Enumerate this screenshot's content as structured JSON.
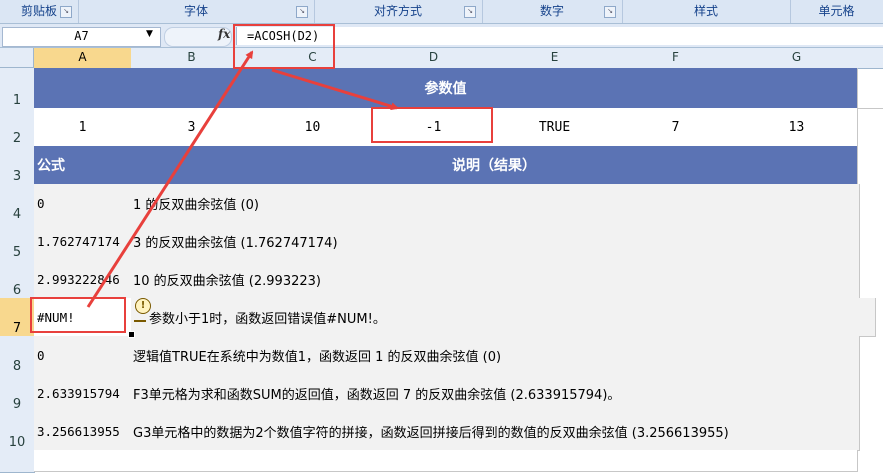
{
  "ribbon": {
    "groups": [
      "剪贴板",
      "字体",
      "对齐方式",
      "数字",
      "样式",
      "单元格"
    ]
  },
  "formula_bar": {
    "name_box": "A7",
    "fx_label": "fx",
    "formula": "=ACOSH(D2)"
  },
  "columns": [
    "A",
    "B",
    "C",
    "D",
    "E",
    "F",
    "G"
  ],
  "rows": [
    "1",
    "2",
    "3",
    "4",
    "5",
    "6",
    "7",
    "8",
    "9",
    "10"
  ],
  "sheet": {
    "title": "参数值",
    "params": [
      "1",
      "3",
      "10",
      "-1",
      "TRUE",
      "7",
      "13"
    ],
    "formula_header": "公式",
    "desc_header": "说明（结果）",
    "results": [
      {
        "value": "0",
        "desc": "1 的反双曲余弦值 (0)"
      },
      {
        "value": "1.762747174",
        "desc": "3 的反双曲余弦值 (1.762747174)"
      },
      {
        "value": "2.993222846",
        "desc": "10 的反双曲余弦值 (2.993223)"
      },
      {
        "value": "#NUM!",
        "desc": "参数小于1时，函数返回错误值#NUM!。"
      },
      {
        "value": "0",
        "desc": "逻辑值TRUE在系统中为数值1，函数返回 1 的反双曲余弦值 (0)"
      },
      {
        "value": "2.633915794",
        "desc": "F3单元格为求和函数SUM的返回值，函数返回 7 的反双曲余弦值 (2.633915794)。"
      },
      {
        "value": "3.256613955",
        "desc": "G3单元格中的数据为2个数值字符的拼接，函数返回拼接后得到的数值的反双曲余弦值 (3.256613955)"
      }
    ]
  },
  "colors": {
    "header_band": "#5b73b4",
    "highlight": "#e8403c",
    "selected_header": "#f8d88e"
  },
  "icons": [
    "dropdown-arrow-icon",
    "fx-icon",
    "error-warning-icon",
    "dialog-launcher-icon"
  ]
}
